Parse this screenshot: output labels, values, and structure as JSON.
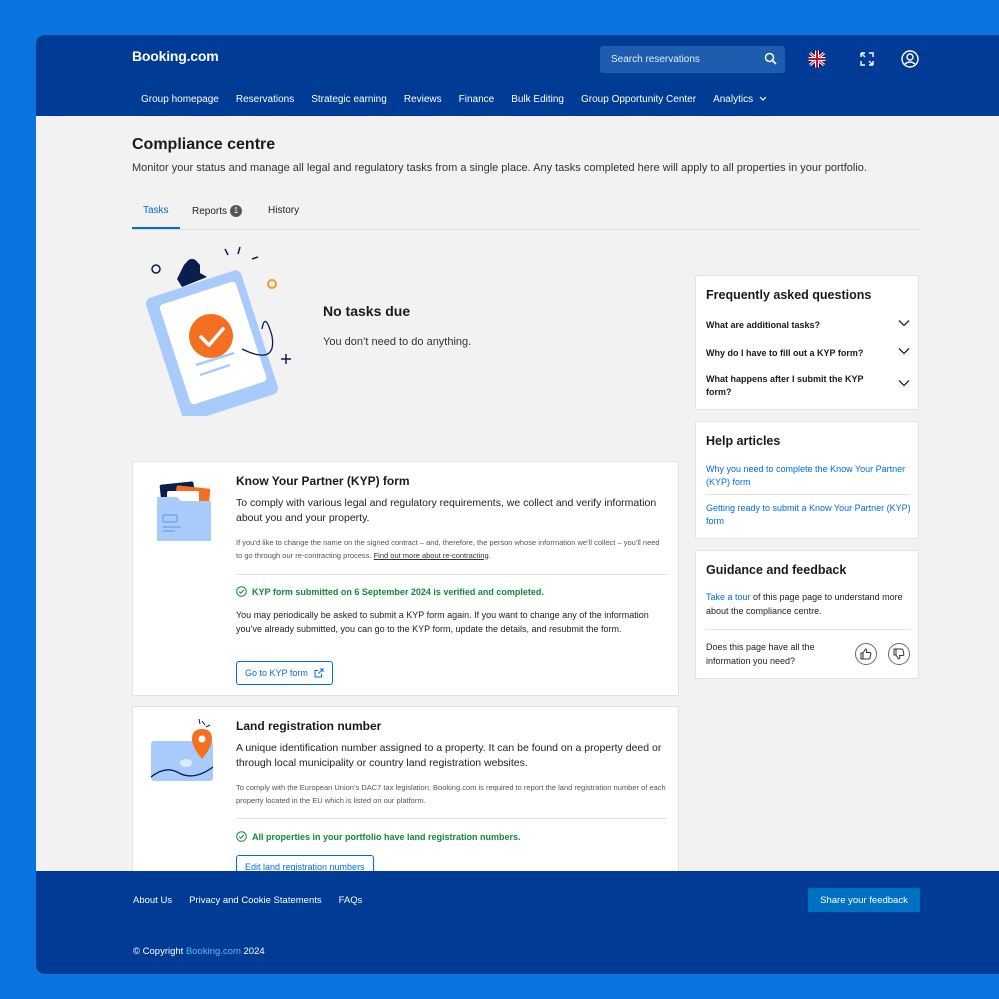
{
  "header": {
    "logo": "Booking.com",
    "search_placeholder": "Search reservations",
    "nav": [
      {
        "label": "Group homepage"
      },
      {
        "label": "Reservations"
      },
      {
        "label": "Strategic earning"
      },
      {
        "label": "Reviews"
      },
      {
        "label": "Finance"
      },
      {
        "label": "Bulk Editing"
      },
      {
        "label": "Group Opportunity Center"
      },
      {
        "label": "Analytics"
      }
    ]
  },
  "page": {
    "title": "Compliance centre",
    "description": "Monitor your status and manage all legal and regulatory tasks from a single place. Any tasks completed here will apply to all properties in your portfolio.",
    "tabs": [
      {
        "label": "Tasks"
      },
      {
        "label": "Reports",
        "badge": "1"
      },
      {
        "label": "History"
      }
    ]
  },
  "empty_state": {
    "title": "No tasks due",
    "subtitle": "You don’t need to do anything."
  },
  "kyp": {
    "title": "Know Your Partner (KYP) form",
    "lead": "To comply with various legal and regulatory requirements, we collect and verify information about you and your property.",
    "note": "If you’d like to change the name on the signed contract – and, therefore, the person whose information we’ll collect – you’ll need to go through our re-contracting process.",
    "note_link": "Find out more about re-contracting",
    "status": "KYP form submitted on 6 September 2024 is verified and completed.",
    "body": "You may periodically be asked to submit a KYP form again. If you want to change any of the information you’ve already submitted, you can go to the KYP form, update the details, and resubmit the form.",
    "button": "Go to KYP form"
  },
  "land": {
    "title": "Land registration number",
    "lead": "A unique identification number assigned to a property. It can be found on a property deed or through local municipality or country land registration websites.",
    "note": "To comply with the European Union’s DAC7 tax legislation, Booking.com is required to report the land registration number of each property located in the EU which is listed on our platform.",
    "status": "All properties in your portfolio have land registration numbers.",
    "button": "Edit land registration numbers"
  },
  "faq": {
    "title": "Frequently asked questions",
    "items": [
      {
        "q": "What are additional tasks?"
      },
      {
        "q": "Why do I have to fill out a KYP form?"
      },
      {
        "q": "What happens after I submit the KYP form?"
      }
    ]
  },
  "help": {
    "title": "Help articles",
    "links": [
      {
        "label": "Why you need to complete the Know Your Partner (KYP) form"
      },
      {
        "label": "Getting ready to submit a Know Your Partner (KYP) form"
      }
    ]
  },
  "guidance": {
    "title": "Guidance and feedback",
    "tour_link": "Take a tour",
    "tour_text": " of this page page to understand more about the compliance centre.",
    "question": "Does this page have all the information you need?"
  },
  "footer": {
    "links": [
      {
        "label": "About Us"
      },
      {
        "label": "Privacy and Cookie Statements"
      },
      {
        "label": "FAQs"
      }
    ],
    "feedback_button": "Share your feedback",
    "copyright_prefix": "© Copyright ",
    "copyright_brand": "Booking.com",
    "copyright_year": " 2024"
  },
  "colors": {
    "brand_blue": "#003b95",
    "accent": "#006ce4",
    "success": "#118a3a"
  }
}
